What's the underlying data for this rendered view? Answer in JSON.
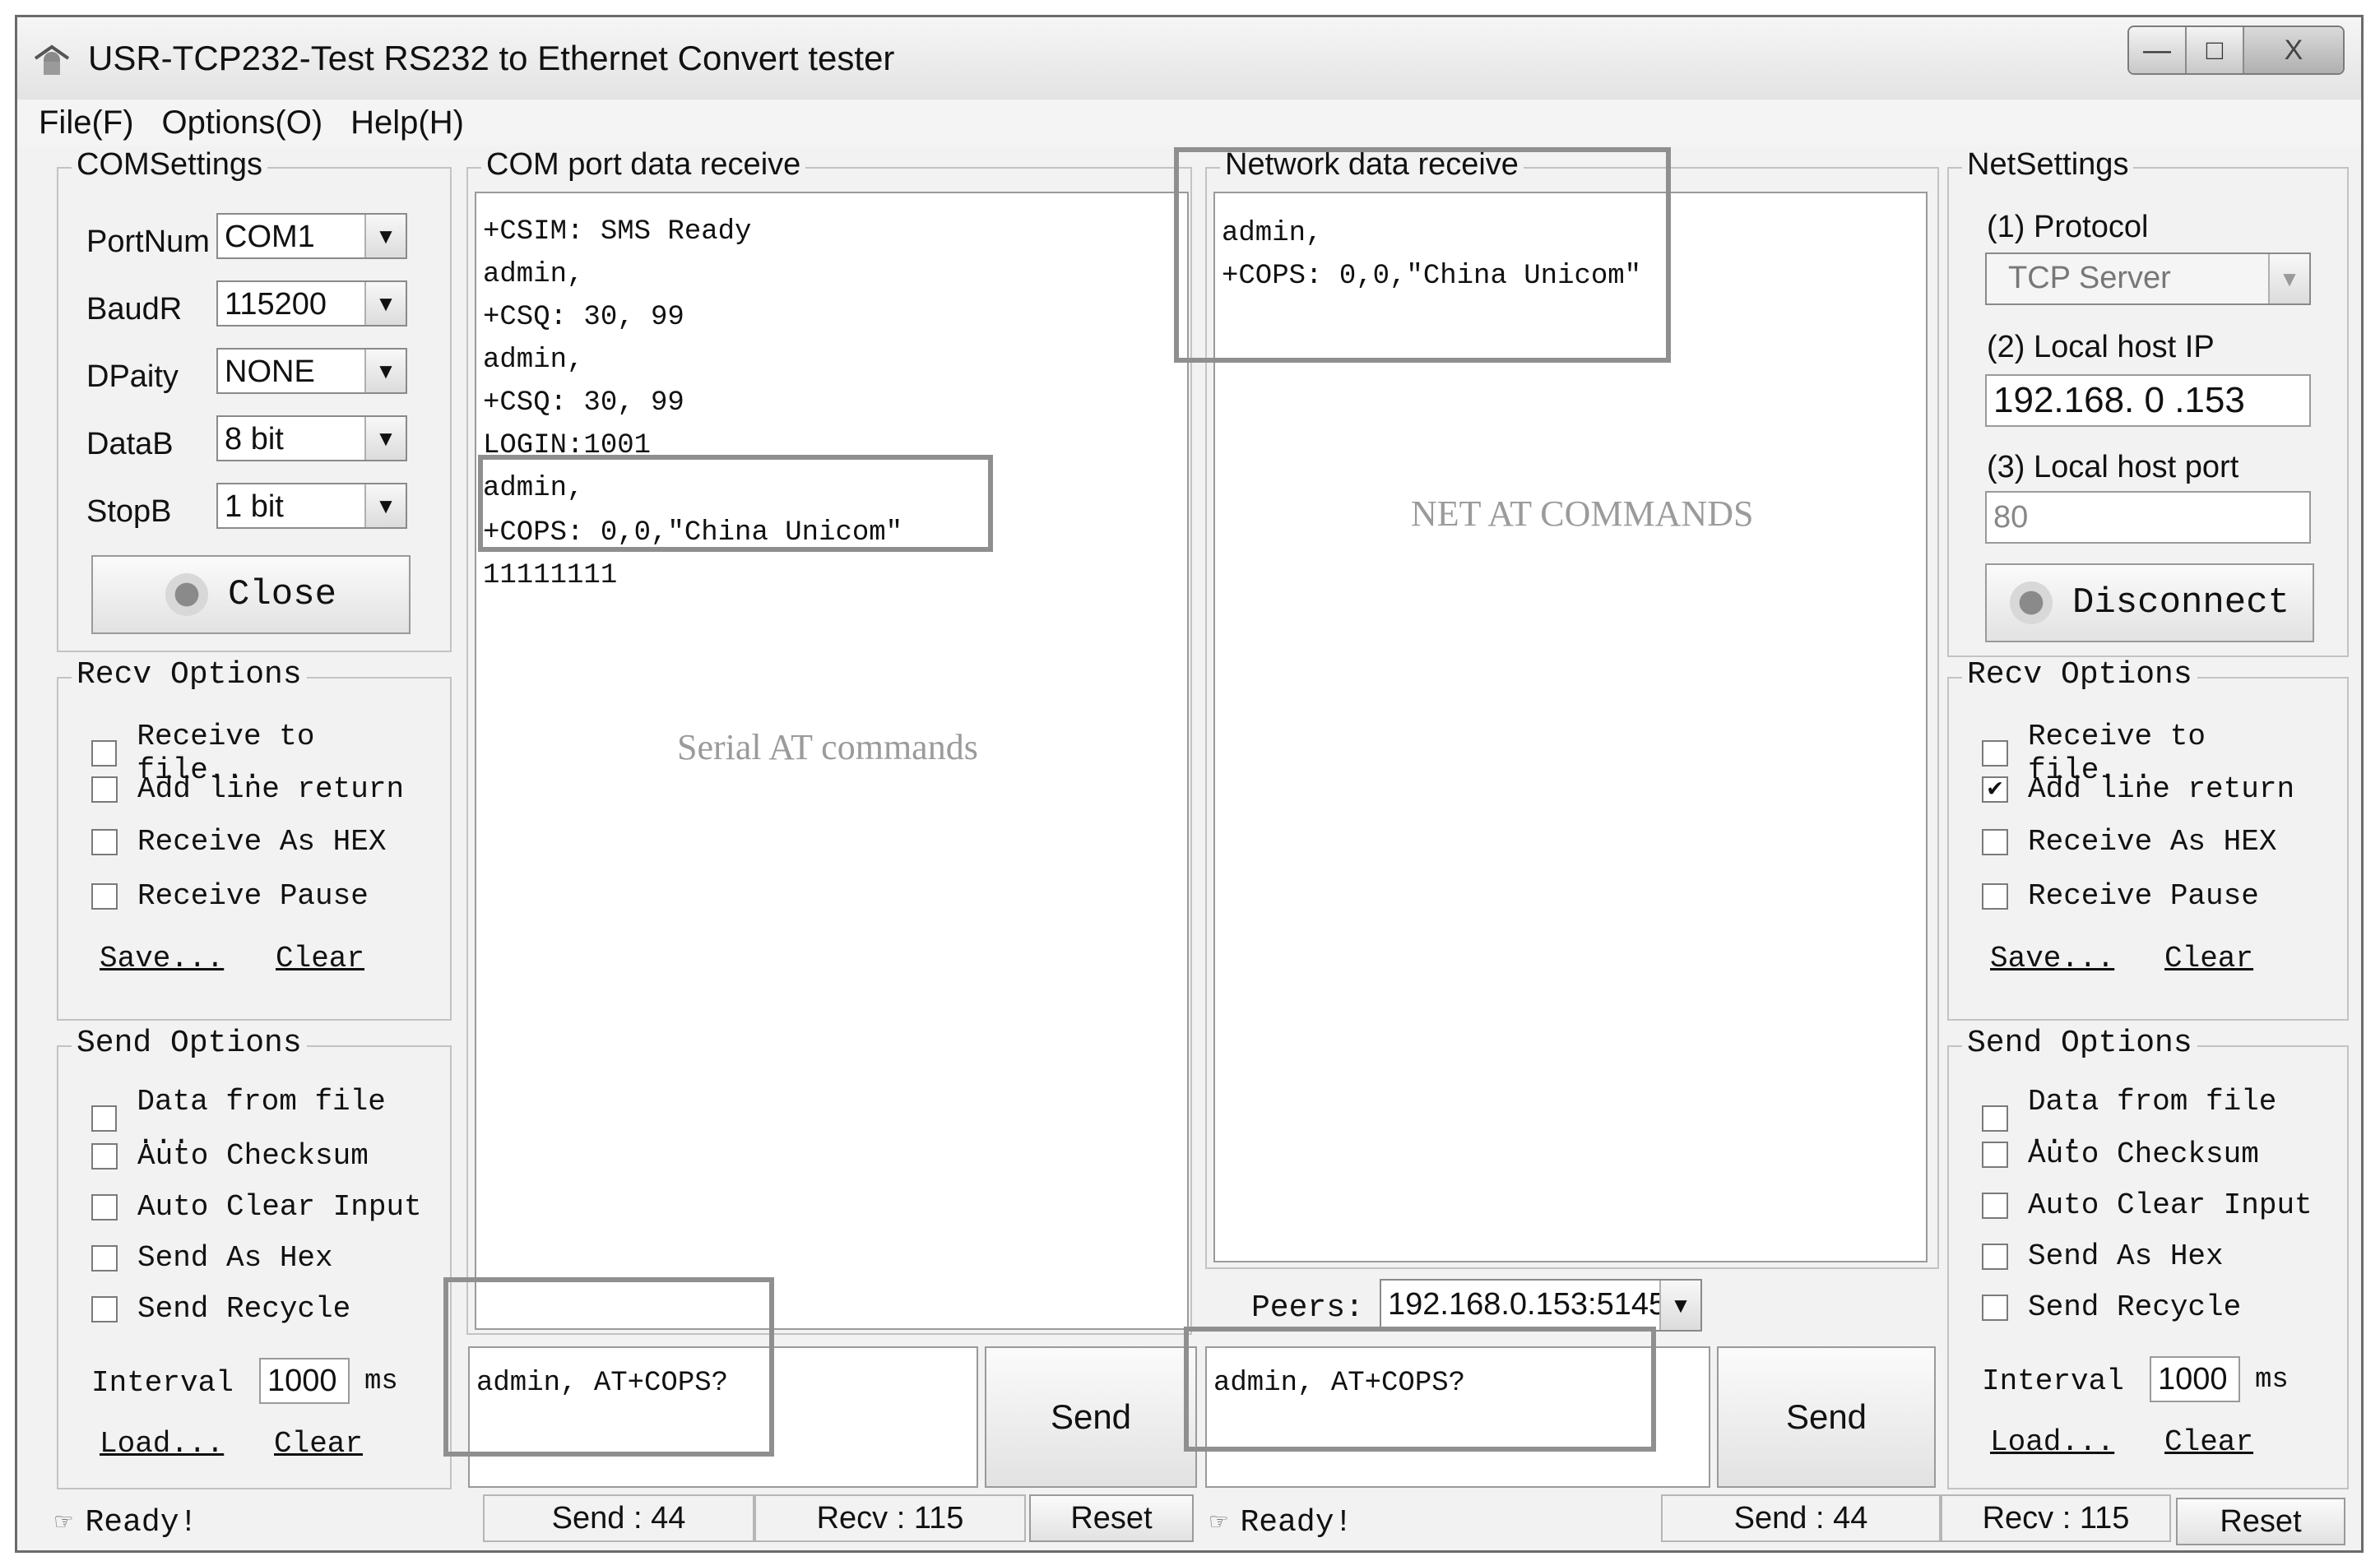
{
  "window": {
    "title": "USR-TCP232-Test  RS232 to Ethernet Convert tester",
    "controls": [
      "—",
      "□",
      "X"
    ]
  },
  "menu": [
    "File(F)",
    "Options(O)",
    "Help(H)"
  ],
  "com_settings": {
    "legend": "COMSettings",
    "fields": [
      {
        "label": "PortNum",
        "value": "COM1"
      },
      {
        "label": "BaudR",
        "value": "115200"
      },
      {
        "label": "DPaity",
        "value": "NONE"
      },
      {
        "label": "DataB",
        "value": "8 bit"
      },
      {
        "label": "StopB",
        "value": "1 bit"
      }
    ],
    "button": "Close"
  },
  "left_recv_options": {
    "legend": "Recv Options",
    "items": [
      {
        "label": "Receive to file...",
        "checked": false
      },
      {
        "label": "Add line return",
        "checked": false
      },
      {
        "label": "Receive As HEX",
        "checked": false
      },
      {
        "label": "Receive Pause",
        "checked": false
      }
    ],
    "save": "Save...",
    "clear": "Clear"
  },
  "left_send_options": {
    "legend": "Send Options",
    "items": [
      {
        "label": "Data from file ...",
        "checked": false
      },
      {
        "label": "Auto Checksum",
        "checked": false
      },
      {
        "label": "Auto Clear Input",
        "checked": false
      },
      {
        "label": "Send As Hex",
        "checked": false
      },
      {
        "label": "Send Recycle",
        "checked": false
      }
    ],
    "interval_label": "Interval",
    "interval_value": "1000",
    "interval_unit": "ms",
    "load": "Load...",
    "clear": "Clear"
  },
  "com_receive": {
    "legend": "COM port data receive",
    "lines": [
      "+CSIM: SMS Ready",
      "admin,",
      "+CSQ: 30, 99",
      "admin,",
      "+CSQ: 30, 99",
      "LOGIN:1001",
      "admin,",
      "+COPS: 0,0,\"China Unicom\"",
      "11111111"
    ],
    "overlay": "Serial AT commands"
  },
  "com_send": {
    "text": "admin, AT+COPS?",
    "button": "Send"
  },
  "net_receive": {
    "legend": "Network data receive",
    "lines": [
      "admin,",
      "+COPS: 0,0,\"China Unicom\""
    ],
    "overlay": "NET AT COMMANDS"
  },
  "peers": {
    "label": "Peers:",
    "value": "192.168.0.153:5145"
  },
  "net_send": {
    "text": "admin, AT+COPS?",
    "button": "Send"
  },
  "net_settings": {
    "legend": "NetSettings",
    "protocol_label": "(1) Protocol",
    "protocol_value": "TCP Server",
    "ip_label": "(2) Local host IP",
    "ip_value": "192.168. 0 .153",
    "port_label": "(3) Local host port",
    "port_value": "80",
    "button": "Disconnect"
  },
  "right_recv_options": {
    "legend": "Recv Options",
    "items": [
      {
        "label": "Receive to file...",
        "checked": false
      },
      {
        "label": "Add line return",
        "checked": true
      },
      {
        "label": "Receive As HEX",
        "checked": false
      },
      {
        "label": "Receive Pause",
        "checked": false
      }
    ],
    "save": "Save...",
    "clear": "Clear"
  },
  "right_send_options": {
    "legend": "Send Options",
    "items": [
      {
        "label": "Data from file ...",
        "checked": false
      },
      {
        "label": "Auto Checksum",
        "checked": false
      },
      {
        "label": "Auto Clear Input",
        "checked": false
      },
      {
        "label": "Send As Hex",
        "checked": false
      },
      {
        "label": "Send Recycle",
        "checked": false
      }
    ],
    "interval_label": "Interval",
    "interval_value": "1000",
    "interval_unit": "ms",
    "load": "Load...",
    "clear": "Clear"
  },
  "status_left": {
    "text": "Ready!",
    "send": "Send : 44",
    "recv": "Recv : 115",
    "reset": "Reset"
  },
  "status_right": {
    "text": "Ready!",
    "send": "Send : 44",
    "recv": "Recv : 115",
    "reset": "Reset"
  }
}
